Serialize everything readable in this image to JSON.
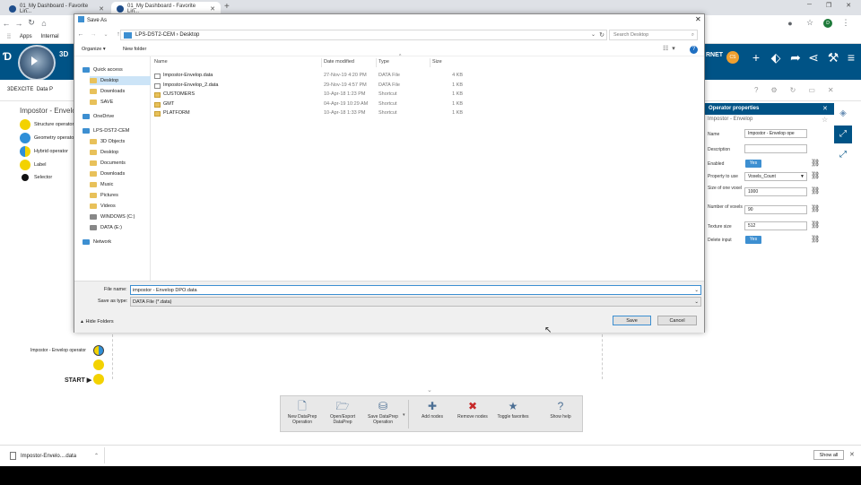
{
  "browser": {
    "tabs": [
      {
        "label": "01_My Dashboard - Favorite Lin..."
      },
      {
        "label": "01_My Dashboard - Favorite Lin..."
      }
    ],
    "bookmarks": [
      {
        "label": "Apps"
      },
      {
        "label": "Internal"
      }
    ]
  },
  "app": {
    "brand": "3D",
    "section_label": "3DEXCITE",
    "section_sub": "Data P",
    "user_initials": "CS",
    "user_name_fragment": "RNET"
  },
  "legend": {
    "title": "Impostor - Envelop",
    "items": [
      {
        "label": "Structure operator",
        "color": "#f3d200"
      },
      {
        "label": "Geometry operator",
        "color": "#2f8fd8"
      },
      {
        "label": "Hybrid operator",
        "color": "#f3d200"
      },
      {
        "label": "Label",
        "color": "#f3d200"
      },
      {
        "label": "Selector",
        "color": "#111111"
      }
    ]
  },
  "graph": {
    "operator_label": "Impostor - Envelop operator",
    "start_label": "START"
  },
  "operator_panel": {
    "title": "Operator properties",
    "subtitle": "Impostor - Envelop",
    "fields": [
      {
        "label": "Name",
        "value": "Impostor - Envelop ope",
        "kind": "text"
      },
      {
        "label": "Description",
        "value": "",
        "kind": "text"
      },
      {
        "label": "Enabled",
        "value": "Yes",
        "kind": "toggle"
      },
      {
        "label": "Property to use",
        "value": "Voxels_Count",
        "kind": "select"
      },
      {
        "label": "Size of one voxel",
        "value": "1000",
        "kind": "number"
      },
      {
        "label": "Number of voxels",
        "value": "90",
        "kind": "number"
      },
      {
        "label": "Texture size",
        "value": "512",
        "kind": "number"
      },
      {
        "label": "Delete input",
        "value": "Yes",
        "kind": "toggle"
      }
    ]
  },
  "dialog": {
    "title": "Save As",
    "path": [
      "LPS-DST2-CEM",
      "Desktop"
    ],
    "search_placeholder": "Search Desktop",
    "organize": "Organize",
    "new_folder": "New folder",
    "tree": [
      {
        "label": "Quick access",
        "icon": "star-icon"
      },
      {
        "label": "Desktop",
        "icon": "folder-icon"
      },
      {
        "label": "Downloads",
        "icon": "folder-icon"
      },
      {
        "label": "SAVE",
        "icon": "folder-icon"
      },
      {
        "label": "OneDrive",
        "icon": "cloud-icon"
      },
      {
        "label": "LPS-DST2-CEM",
        "icon": "computer-icon"
      },
      {
        "label": "3D Objects",
        "icon": "folder-icon"
      },
      {
        "label": "Desktop",
        "icon": "folder-icon"
      },
      {
        "label": "Documents",
        "icon": "folder-icon"
      },
      {
        "label": "Downloads",
        "icon": "folder-icon"
      },
      {
        "label": "Music",
        "icon": "folder-icon"
      },
      {
        "label": "Pictures",
        "icon": "folder-icon"
      },
      {
        "label": "Videos",
        "icon": "folder-icon"
      },
      {
        "label": "WINDOWS (C:)",
        "icon": "drive-icon"
      },
      {
        "label": "DATA (E:)",
        "icon": "drive-icon"
      },
      {
        "label": "Network",
        "icon": "network-icon"
      }
    ],
    "columns": {
      "name": "Name",
      "date": "Date modified",
      "type": "Type",
      "size": "Size"
    },
    "files": [
      {
        "name": "Impostor-Envelop.data",
        "date": "27-Nov-19 4:20 PM",
        "type": "DATA File",
        "size": "4 KB",
        "icon": "file-icon"
      },
      {
        "name": "Impostor-Envelop_2.data",
        "date": "29-Nov-19 4:57 PM",
        "type": "DATA File",
        "size": "1 KB",
        "icon": "file-icon"
      },
      {
        "name": "CUSTOMERS",
        "date": "10-Apr-18 1:23 PM",
        "type": "Shortcut",
        "size": "1 KB",
        "icon": "folder-icon"
      },
      {
        "name": "GMT",
        "date": "04-Apr-19 10:29 AM",
        "type": "Shortcut",
        "size": "1 KB",
        "icon": "folder-icon"
      },
      {
        "name": "PLATFORM",
        "date": "10-Apr-18 1:33 PM",
        "type": "Shortcut",
        "size": "1 KB",
        "icon": "folder-icon"
      }
    ],
    "file_name_label": "File name:",
    "file_name_value": "impostor - Envelop DPO.data",
    "save_type_label": "Save as type:",
    "save_type_value": "DATA File (*.data)",
    "hide_folders": "Hide Folders",
    "save": "Save",
    "cancel": "Cancel"
  },
  "toolbar": [
    {
      "label": "New DataPrep Operation",
      "icon": "new-operation-icon",
      "glyph": "🗋"
    },
    {
      "label": "Open/Export DataPrep",
      "icon": "open-export-icon",
      "glyph": "🗁"
    },
    {
      "label": "Save DataPrep Operation",
      "icon": "save-operation-icon",
      "glyph": "⛁"
    },
    {
      "label": "Add nodes",
      "icon": "add-nodes-icon",
      "glyph": "✚"
    },
    {
      "label": "Remove nodes",
      "icon": "remove-nodes-icon",
      "glyph": "✖"
    },
    {
      "label": "Toggle favorites",
      "icon": "toggle-favorites-icon",
      "glyph": "★"
    },
    {
      "label": "Show help",
      "icon": "help-icon",
      "glyph": "?"
    }
  ],
  "download": {
    "file": "Impostor-Envelo....data",
    "show_all": "Show all"
  }
}
